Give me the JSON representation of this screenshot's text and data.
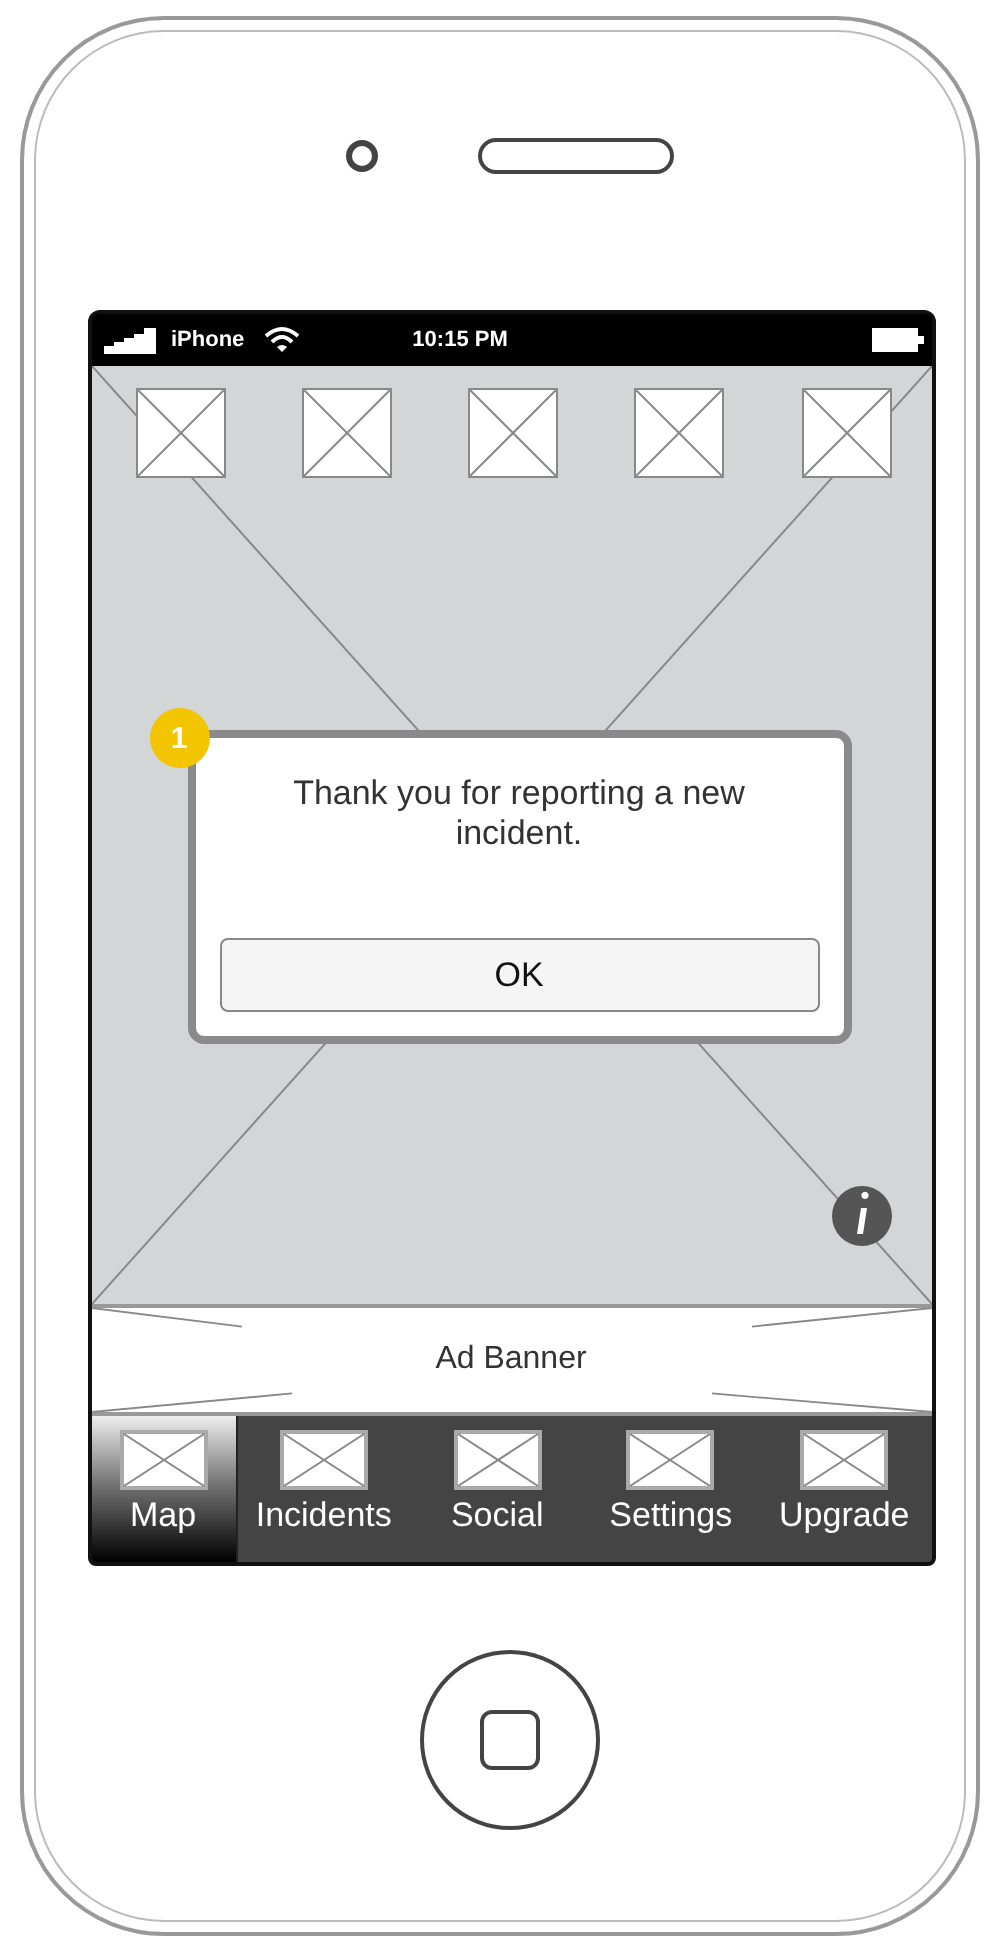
{
  "status_bar": {
    "carrier": "iPhone",
    "time": "10:15 PM"
  },
  "dialog": {
    "marker": "1",
    "message": "Thank you for reporting a new incident.",
    "button": "OK"
  },
  "ad_banner": {
    "label": "Ad Banner"
  },
  "tab_bar": [
    {
      "label": "Map",
      "selected": true
    },
    {
      "label": "Incidents",
      "selected": false
    },
    {
      "label": "Social",
      "selected": false
    },
    {
      "label": "Settings",
      "selected": false
    },
    {
      "label": "Upgrade",
      "selected": false
    }
  ]
}
